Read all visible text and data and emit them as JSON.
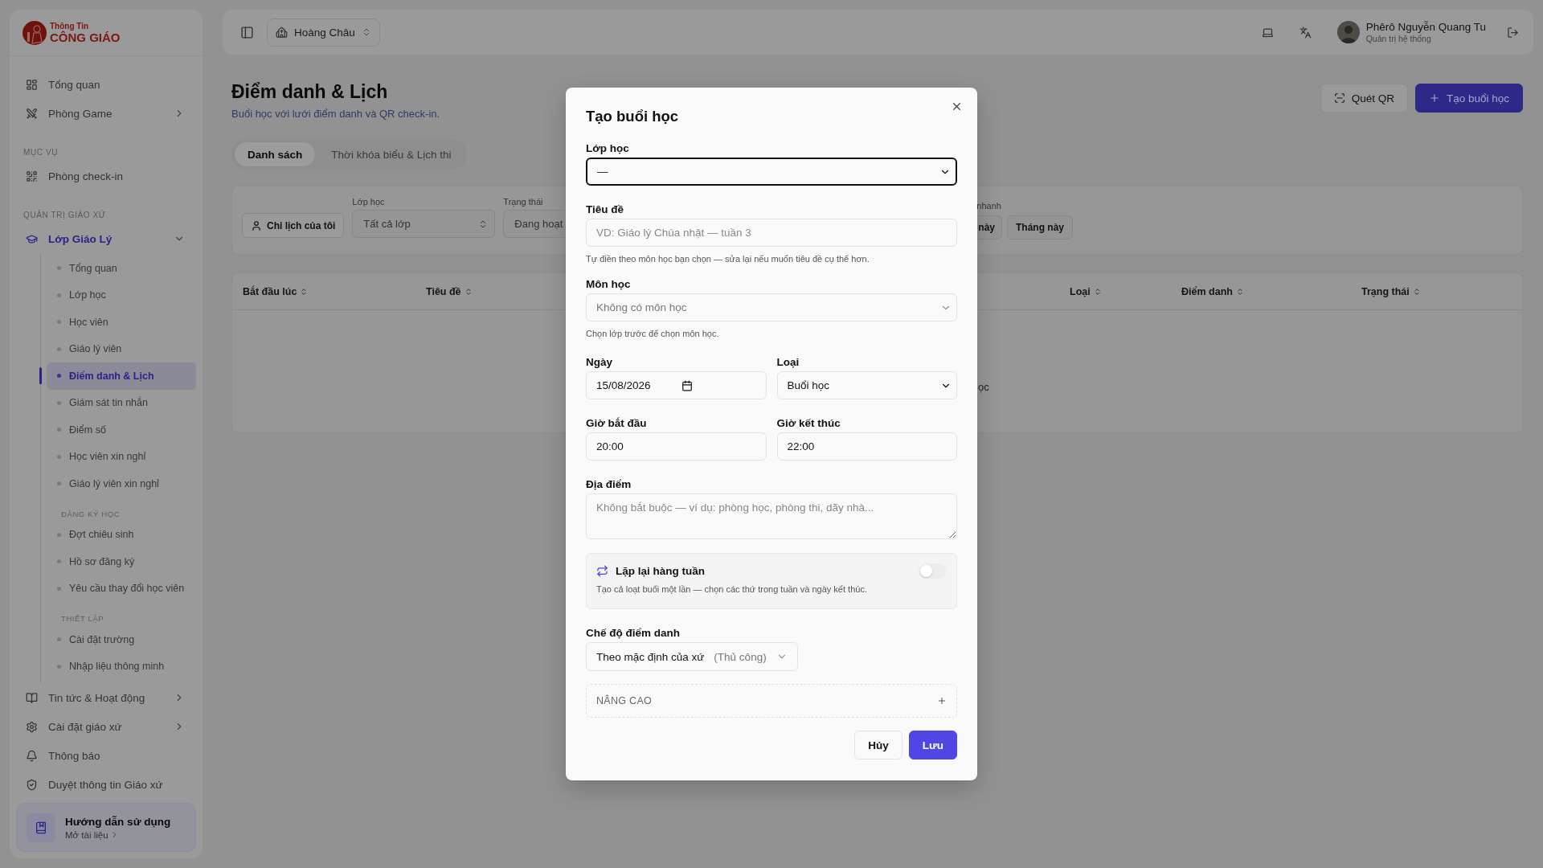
{
  "sidebar": {
    "logo": {
      "line1": "Thông Tin",
      "line2": "CÔNG GIÁO"
    },
    "items": [
      {
        "kind": "link",
        "label": "Tổng quan",
        "selected": false
      },
      {
        "kind": "link",
        "label": "Phòng Game",
        "selected": false,
        "expanded": false
      },
      {
        "kind": "heading",
        "label": "MỤC VỤ"
      },
      {
        "kind": "link",
        "label": "Phòng check-in",
        "selected": false
      },
      {
        "kind": "heading",
        "label": "QUẢN TRỊ GIÁO XỨ"
      },
      {
        "kind": "link",
        "label": "Lớp Giáo Lý",
        "selected": true,
        "expanded": true,
        "children": [
          {
            "kind": "link",
            "label": "Tổng quan",
            "selected": false
          },
          {
            "kind": "link",
            "label": "Lớp học",
            "selected": false
          },
          {
            "kind": "link",
            "label": "Học viên",
            "selected": false
          },
          {
            "kind": "link",
            "label": "Giáo lý viên",
            "selected": false
          },
          {
            "kind": "link",
            "label": "Điểm danh & Lịch",
            "selected": true
          },
          {
            "kind": "link",
            "label": "Giám sát tin nhắn",
            "selected": false
          },
          {
            "kind": "link",
            "label": "Điểm số",
            "selected": false
          },
          {
            "kind": "link",
            "label": "Học viên xin nghỉ",
            "selected": false
          },
          {
            "kind": "link",
            "label": "Giáo lý viên xin nghỉ",
            "selected": false
          },
          {
            "kind": "heading",
            "label": "ĐĂNG KÝ HỌC"
          },
          {
            "kind": "link",
            "label": "Đợt chiêu sinh",
            "selected": false
          },
          {
            "kind": "link",
            "label": "Hồ sơ đăng ký",
            "selected": false
          },
          {
            "kind": "link",
            "label": "Yêu cầu thay đổi học viên",
            "selected": false
          },
          {
            "kind": "heading",
            "label": "THIẾT LẬP"
          },
          {
            "kind": "link",
            "label": "Cài đặt trường",
            "selected": false
          },
          {
            "kind": "link",
            "label": "Nhập liệu thông minh",
            "selected": false
          }
        ]
      },
      {
        "kind": "link",
        "label": "Tin tức & Hoạt động",
        "selected": false,
        "expanded": false
      },
      {
        "kind": "link",
        "label": "Cài đặt giáo xứ",
        "selected": false,
        "expanded": false
      },
      {
        "kind": "link",
        "label": "Thông báo",
        "selected": false
      },
      {
        "kind": "link",
        "label": "Duyệt thông tin Giáo xứ",
        "selected": false
      }
    ],
    "help": {
      "title": "Hướng dẫn sử dụng",
      "link": "Mở tài liệu"
    }
  },
  "header": {
    "workspace": "Hoàng Châu",
    "user_name": "Phêrô Nguyễn Quang Tu",
    "user_role": "Quản trị hệ thống"
  },
  "page": {
    "title": "Điểm danh & Lịch",
    "subtitle": "Buổi học với lưới điểm danh và QR check-in.",
    "actions": [
      {
        "kind": "outline",
        "label": "Quét QR"
      },
      {
        "kind": "primary",
        "label": "Tạo buổi học"
      }
    ],
    "tabs": [
      {
        "label": "Danh sách",
        "selected": true
      },
      {
        "label": "Thời khóa biểu & Lịch thi",
        "selected": false
      }
    ],
    "filters": {
      "my_schedule": "Chỉ lịch của tôi",
      "class_label": "Lớp học",
      "class_value": "Tất cả lớp",
      "status_label": "Trạng thái",
      "status_value": "Đang hoạt",
      "quick_label": "nhanh",
      "quick_buttons": [
        "này",
        "Tháng này"
      ]
    },
    "table": {
      "columns": [
        "Bắt đầu lúc",
        "Tiêu đề",
        "Loại",
        "Điểm danh",
        "Trạng thái"
      ],
      "empty_text": "ọc"
    }
  },
  "dialog": {
    "title": "Tạo buổi học",
    "class": {
      "label": "Lớp học",
      "value": "—",
      "focused": true
    },
    "title_field": {
      "label": "Tiêu đề",
      "placeholder": "VD: Giáo lý Chúa nhật — tuần 3",
      "hint": "Tự điền theo môn học bạn chọn — sửa lại nếu muốn tiêu đề cụ thể hơn."
    },
    "subject": {
      "label": "Môn học",
      "value": "Không có môn học",
      "disabled": true,
      "hint": "Chọn lớp trước để chọn môn học."
    },
    "date": {
      "label": "Ngày",
      "value": "15/08/2026"
    },
    "type": {
      "label": "Loại",
      "value": "Buổi học"
    },
    "start_time": {
      "label": "Giờ bắt đầu",
      "value": "20:00"
    },
    "end_time": {
      "label": "Giờ kết thúc",
      "value": "22:00"
    },
    "location": {
      "label": "Địa điểm",
      "placeholder": "Không bắt buộc — ví dụ: phòng học, phòng thi, dãy nhà..."
    },
    "repeat": {
      "label": "Lặp lại hàng tuần",
      "description": "Tạo cả loạt buổi một lần — chọn các thứ trong tuần và ngày kết thúc.",
      "on": false
    },
    "attendance_mode": {
      "label": "Chế độ điểm danh",
      "value": "Theo mặc định của xứ",
      "note": "(Thủ công)"
    },
    "advanced": {
      "label": "NÂNG CAO",
      "expanded": false
    },
    "buttons": [
      {
        "kind": "secondary",
        "label": "Hủy"
      },
      {
        "kind": "primary",
        "label": "Lưu"
      }
    ]
  }
}
